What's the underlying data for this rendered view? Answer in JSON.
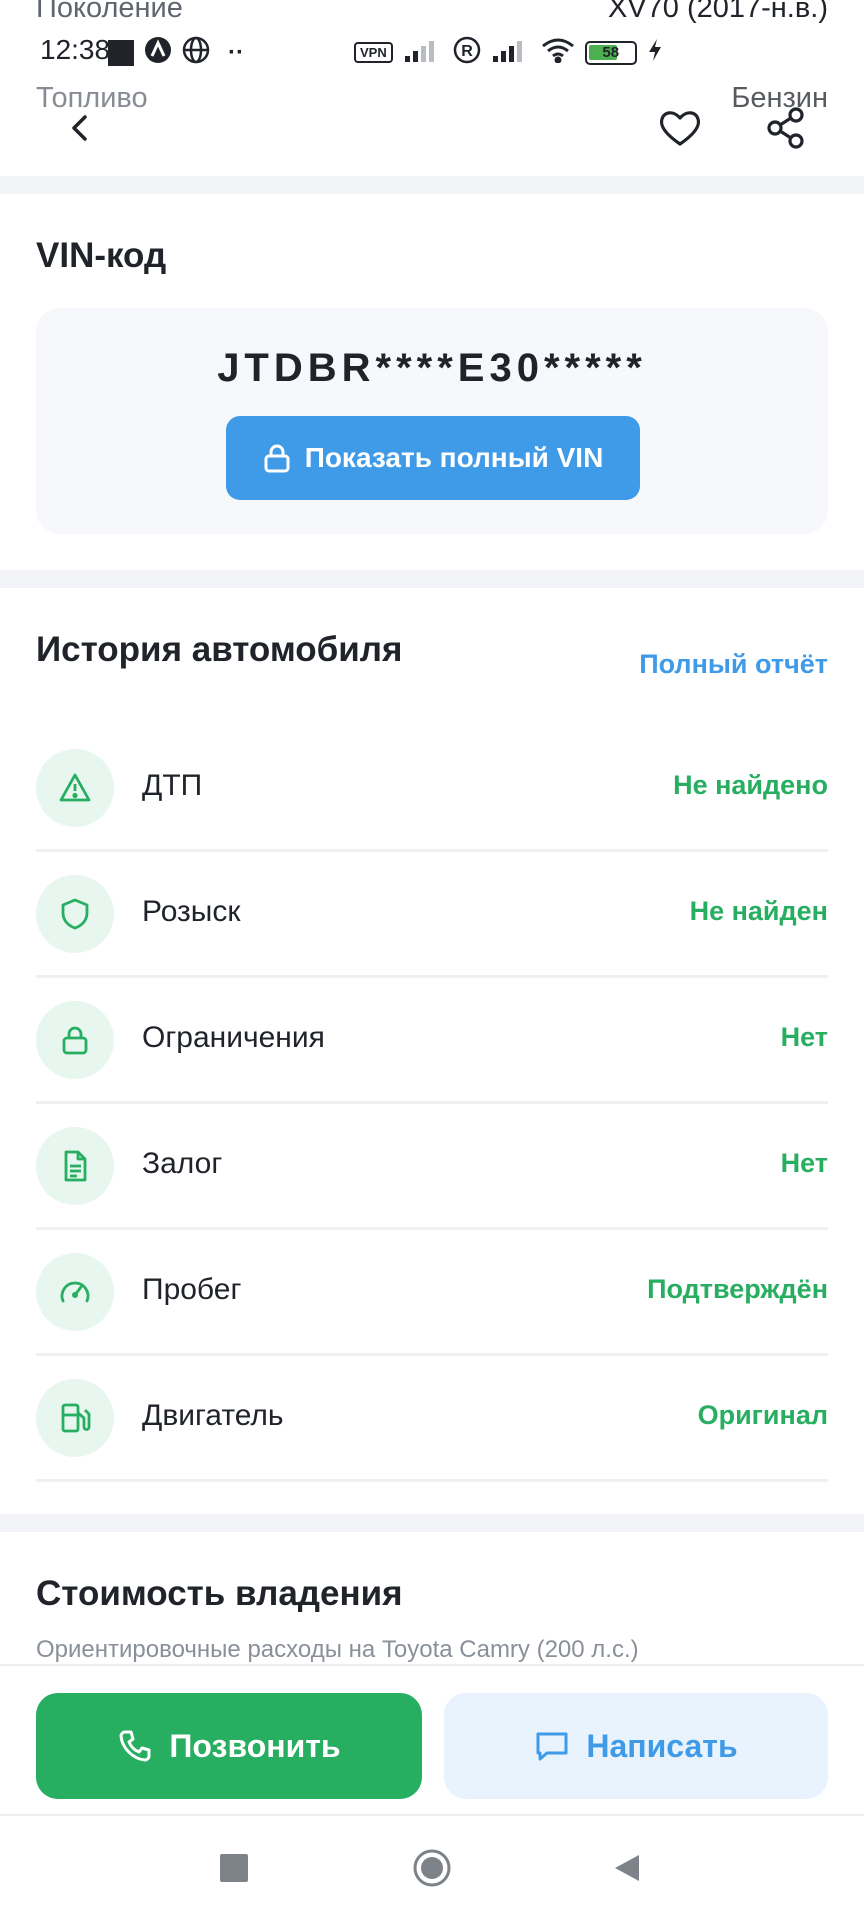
{
  "spec_rows_partial": [
    {
      "label": "Поколение",
      "value": "XV70 (2017-н.в.)"
    },
    {
      "label": "Топливо",
      "value": "Бензин"
    }
  ],
  "status_bar": {
    "time": "12:38",
    "vpn": "VPN",
    "battery": "58"
  },
  "toolbar": {
    "back_icon": "chevron-left-icon",
    "favorite_icon": "heart-icon",
    "share_icon": "share-icon"
  },
  "vin": {
    "title": "VIN-код",
    "code": "JTDBR****E30*****",
    "button_label": "Показать полный VIN"
  },
  "history": {
    "title": "История автомобиля",
    "link": "Полный отчёт",
    "items": [
      {
        "label": "ДТП",
        "value": "Не найдено",
        "icon": "warning-icon"
      },
      {
        "label": "Розыск",
        "value": "Не найден",
        "icon": "shield-icon"
      },
      {
        "label": "Ограничения",
        "value": "Нет",
        "icon": "lock-icon"
      },
      {
        "label": "Залог",
        "value": "Нет",
        "icon": "document-icon"
      },
      {
        "label": "Пробег",
        "value": "Подтверждён",
        "icon": "speedometer-icon"
      },
      {
        "label": "Двигатель",
        "value": "Оригинал",
        "icon": "fuel-icon"
      }
    ]
  },
  "ownership": {
    "title": "Стоимость владения",
    "subtitle": "Ориентировочные расходы на Toyota Camry (200 л.с.)"
  },
  "actions": {
    "call": "Позвонить",
    "message": "Написать"
  },
  "colors": {
    "accent_blue": "#3f9be8",
    "accent_green": "#27ae60",
    "icon_bg": "#e7f6ee"
  }
}
